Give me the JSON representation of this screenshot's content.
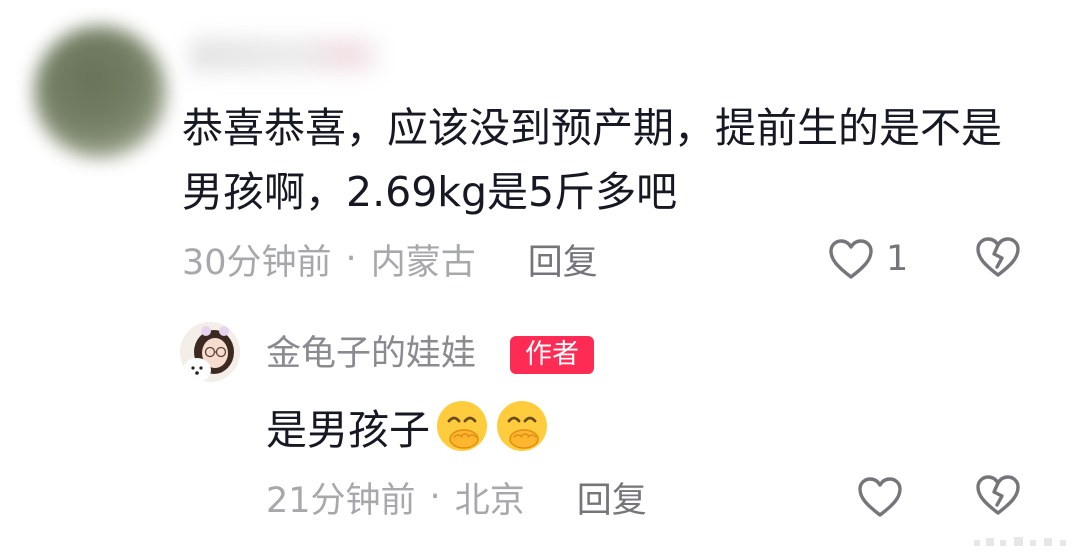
{
  "comment": {
    "text": "恭喜恭喜，应该没到预产期，提前生的是不是男孩啊，2.69kg是5斤多吧",
    "time": "30分钟前",
    "separator": "·",
    "location": "内蒙古",
    "reply_label": "回复",
    "like_count": "1",
    "icons": {
      "like": "heart-outline-icon",
      "dislike": "broken-heart-icon"
    }
  },
  "reply": {
    "author": "金龟子的娃娃",
    "badge": "作者",
    "text": "是男孩子",
    "emoji_count": 2,
    "emoji": "hand-over-mouth-emoji",
    "time": "21分钟前",
    "separator": "·",
    "location": "北京",
    "reply_label": "回复"
  },
  "colors": {
    "text_primary": "#161823",
    "text_meta": "#a7a8ac",
    "author_badge": "#fe2c55"
  }
}
